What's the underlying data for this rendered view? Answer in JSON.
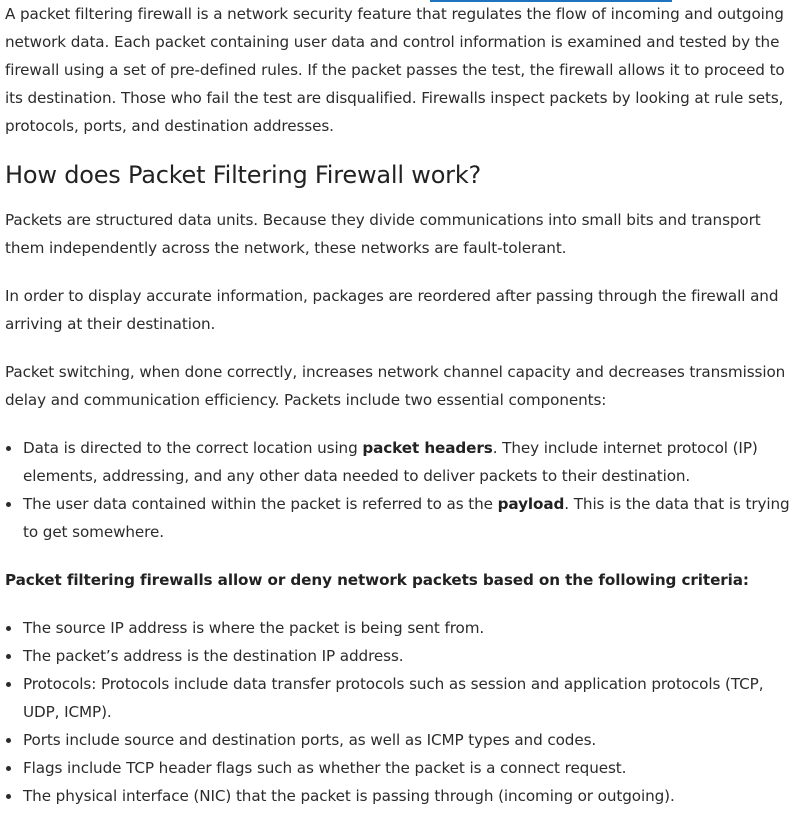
{
  "intro": "A packet filtering firewall is a network security feature that regulates the flow of incoming and outgoing network data. Each packet containing user data and control information is examined and tested by the firewall using a set of pre-defined rules. If the packet passes the test, the firewall allows it to proceed to its destination. Those who fail the test are disqualified. Firewalls inspect packets by looking at rule sets, protocols, ports, and destination addresses.",
  "heading": "How does Packet Filtering Firewall work?",
  "paragraphs": [
    "Packets are structured data units. Because they divide communications into small bits and transport them independently across the network, these networks are fault-tolerant.",
    "In order to display accurate information, packages are reordered after passing through the firewall and arriving at their destination.",
    "Packet switching, when done correctly, increases network channel capacity and decreases transmission delay and communication efficiency. Packets include two essential components:"
  ],
  "components": [
    {
      "before": "Data is directed to the correct location using ",
      "bold": "packet headers",
      "after": ". They include internet protocol (IP) elements, addressing, and any other data needed to deliver packets to their destination."
    },
    {
      "before": "The user data contained within the packet is referred to as the ",
      "bold": "payload",
      "after": ". This is the data that is trying to get somewhere."
    }
  ],
  "criteria_heading": "Packet filtering firewalls allow or deny network packets based on the following criteria:",
  "criteria": [
    "The source IP address is where the packet is being sent from.",
    "The packet’s address is the destination IP address.",
    "Protocols: Protocols include data transfer protocols such as session and application protocols (TCP, UDP, ICMP).",
    "Ports include source and destination ports, as well as ICMP types and codes.",
    "Flags include TCP header flags such as whether the packet is a connect request.",
    "The physical interface (NIC) that the packet is passing through (incoming or outgoing)."
  ]
}
